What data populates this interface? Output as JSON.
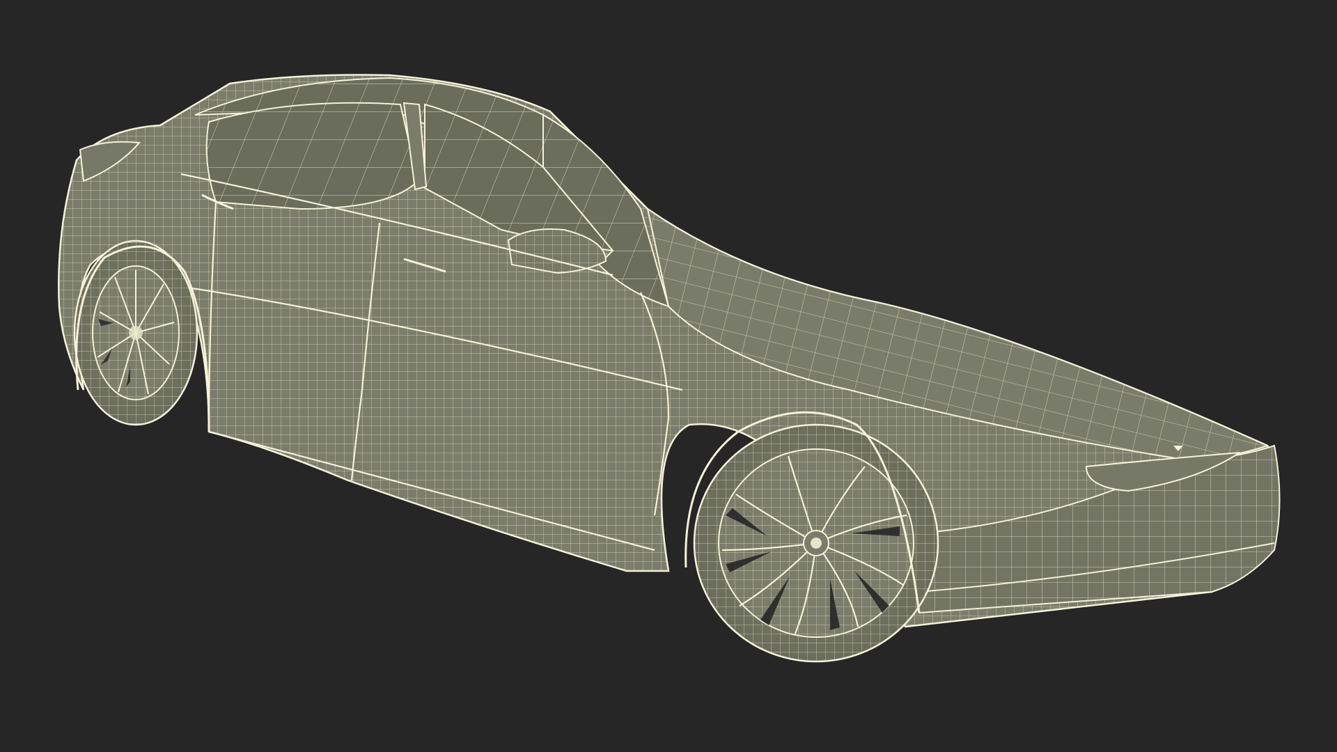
{
  "scene": {
    "subject_icon": "car-wireframe-icon",
    "render_mode": "wireframe",
    "colors": {
      "background": "#262626",
      "body_fill": "#7b7d6c",
      "body_shade": "#6e705f",
      "glass_fill": "#6a6c5c",
      "wire": "#e6e6c8",
      "outline": "#f4f2da"
    }
  }
}
